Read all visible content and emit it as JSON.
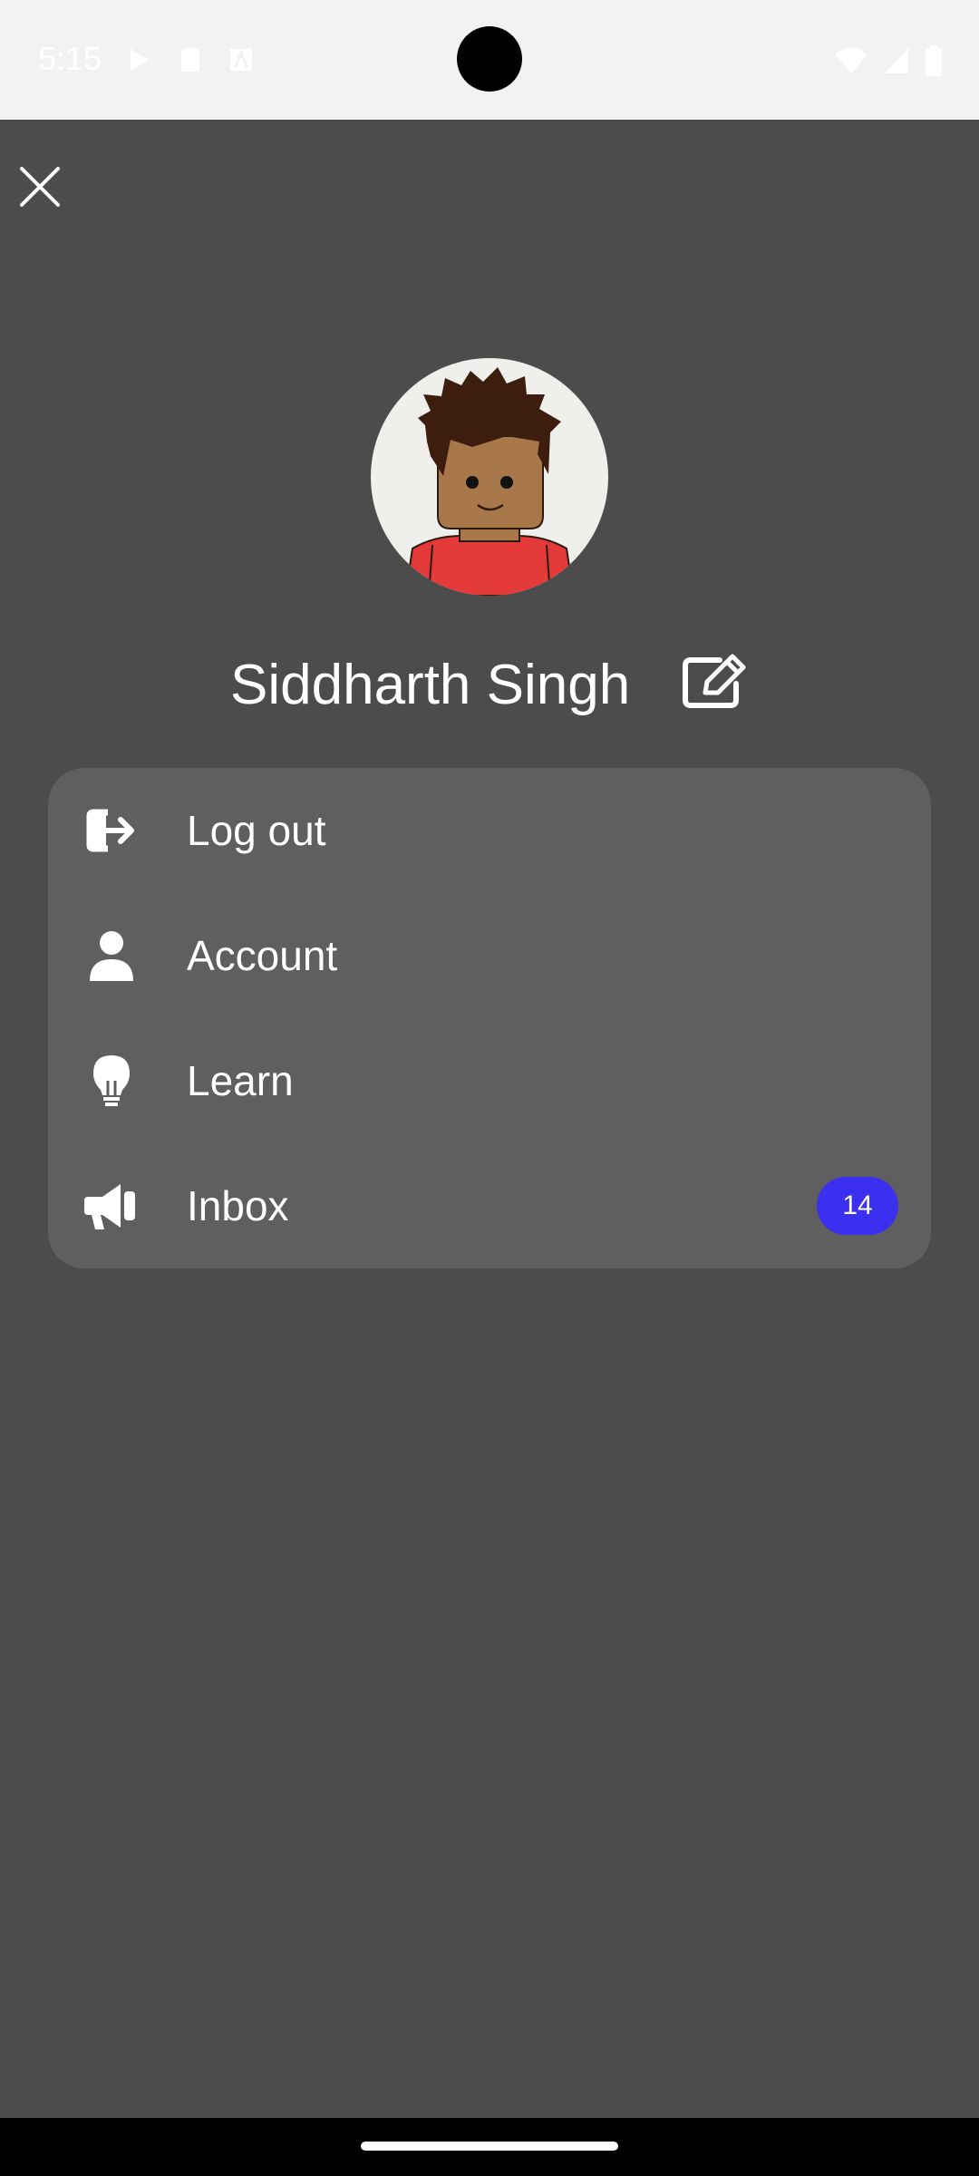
{
  "status_bar": {
    "time": "5:15"
  },
  "drawer": {
    "close_icon": "close-icon",
    "user_name": "Siddharth Singh",
    "edit_icon": "edit-icon"
  },
  "menu": {
    "items": [
      {
        "label": "Log out",
        "icon": "logout-icon"
      },
      {
        "label": "Account",
        "icon": "person-icon"
      },
      {
        "label": "Learn",
        "icon": "lightbulb-icon"
      },
      {
        "label": "Inbox",
        "icon": "megaphone-icon",
        "badge": "14"
      }
    ]
  },
  "colors": {
    "background": "#4c4c4c",
    "card": "#5f5f5f",
    "badge": "#3b2ff0",
    "text": "#ffffff"
  }
}
